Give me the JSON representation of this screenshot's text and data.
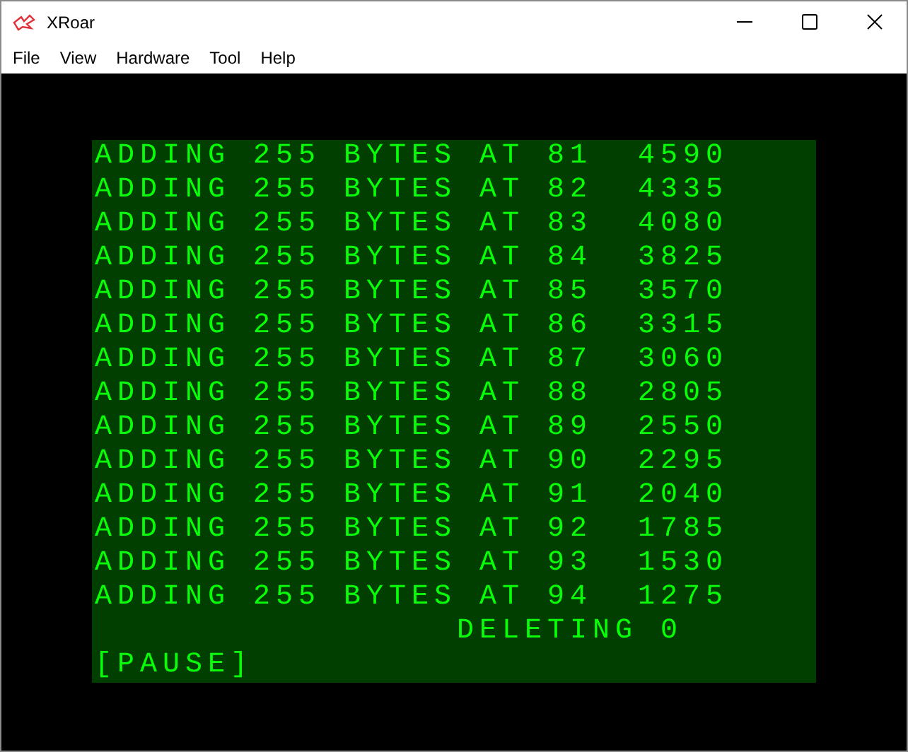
{
  "window": {
    "title": "XRoar"
  },
  "menu": [
    "File",
    "View",
    "Hardware",
    "Tool",
    "Help"
  ],
  "screen": {
    "lines": [
      "ADDING 255 BYTES AT 81  4590",
      "ADDING 255 BYTES AT 82  4335",
      "ADDING 255 BYTES AT 83  4080",
      "ADDING 255 BYTES AT 84  3825",
      "ADDING 255 BYTES AT 85  3570",
      "ADDING 255 BYTES AT 86  3315",
      "ADDING 255 BYTES AT 87  3060",
      "ADDING 255 BYTES AT 88  2805",
      "ADDING 255 BYTES AT 89  2550",
      "ADDING 255 BYTES AT 90  2295",
      "ADDING 255 BYTES AT 91  2040",
      "ADDING 255 BYTES AT 92  1785",
      "ADDING 255 BYTES AT 93  1530",
      "ADDING 255 BYTES AT 94  1275",
      "                DELETING 0",
      "[PAUSE]"
    ]
  }
}
